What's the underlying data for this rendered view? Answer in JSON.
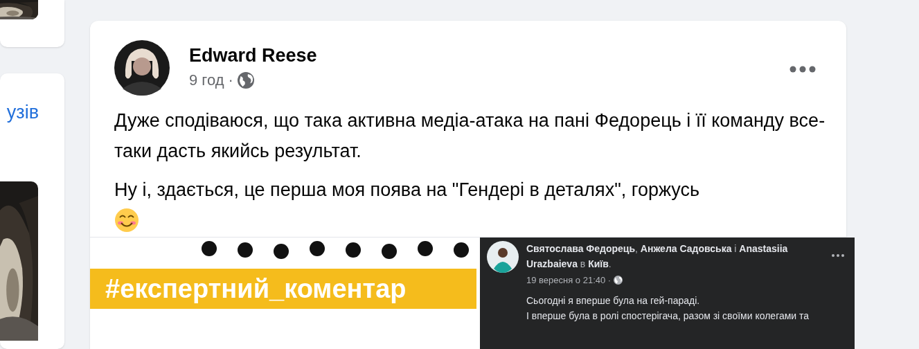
{
  "left_column": {
    "link_text": "узів"
  },
  "post": {
    "author": "Edward Reese",
    "time": "9 год",
    "separator": "·",
    "paragraphs": [
      "Дуже сподіваюся, що така активна медіа-атака на пані Федорець і її команду все-таки дасть якийсь результат.",
      "Ну і, здається, це перша моя поява на \"Гендері в деталях\", горжусь"
    ],
    "image": {
      "banner": "#експертний_коментар",
      "embedded_post": {
        "header": "**Святослава Федорець**, **Анжела Садовська** і **Anastasiia Urazbaieva** в **Київ**.",
        "date": "19 вересня о 21:40",
        "separator": "·",
        "lines": [
          "Сьогодні я вперше була на гей-параді.",
          "І вперше була в ролі спостерігача, разом зі своїми колегами та"
        ]
      }
    }
  }
}
